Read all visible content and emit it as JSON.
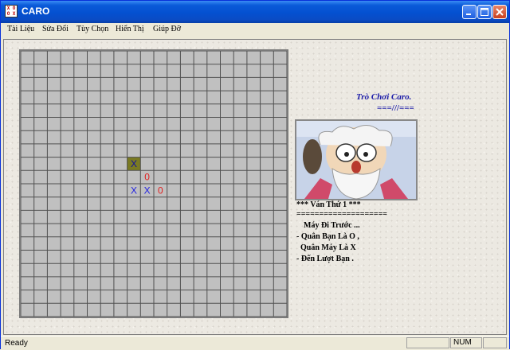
{
  "window": {
    "title": "CARO"
  },
  "menu": [
    "Tài Liệu",
    "Sửa Đổi",
    "Tùy Chọn",
    "Hiển Thị",
    "Giúp Đỡ"
  ],
  "board": {
    "size": 20,
    "marks": [
      {
        "row": 8,
        "col": 8,
        "text": "X",
        "color": "#1010a0",
        "highlight": true
      },
      {
        "row": 9,
        "col": 9,
        "text": "0",
        "color": "#e02020",
        "highlight": false
      },
      {
        "row": 10,
        "col": 8,
        "text": "X",
        "color": "#2020e0",
        "highlight": false
      },
      {
        "row": 10,
        "col": 9,
        "text": "X",
        "color": "#2020e0",
        "highlight": false
      },
      {
        "row": 10,
        "col": 10,
        "text": "0",
        "color": "#e02020",
        "highlight": false
      }
    ],
    "grid_color": "#505050",
    "cell_color": "#c0c0c0",
    "highlight_color": "#7a7a22"
  },
  "panel": {
    "title": "Trò Chơi Caro.",
    "subtitle": "===///===",
    "game_number": "*** Ván Thứ 1 ***",
    "separator": "====================",
    "first_move": "Máy Đi Trước ...",
    "player_piece": "- Quân Bạn Là  O ,",
    "computer_piece": "Quân Máy Là  X",
    "turn": "- Đến Lượt Bạn ."
  },
  "status": {
    "text": "Ready",
    "num": "NUM"
  },
  "colors": {
    "title_blue": "#1a1aa8",
    "titlebar": "#0a50d0"
  }
}
